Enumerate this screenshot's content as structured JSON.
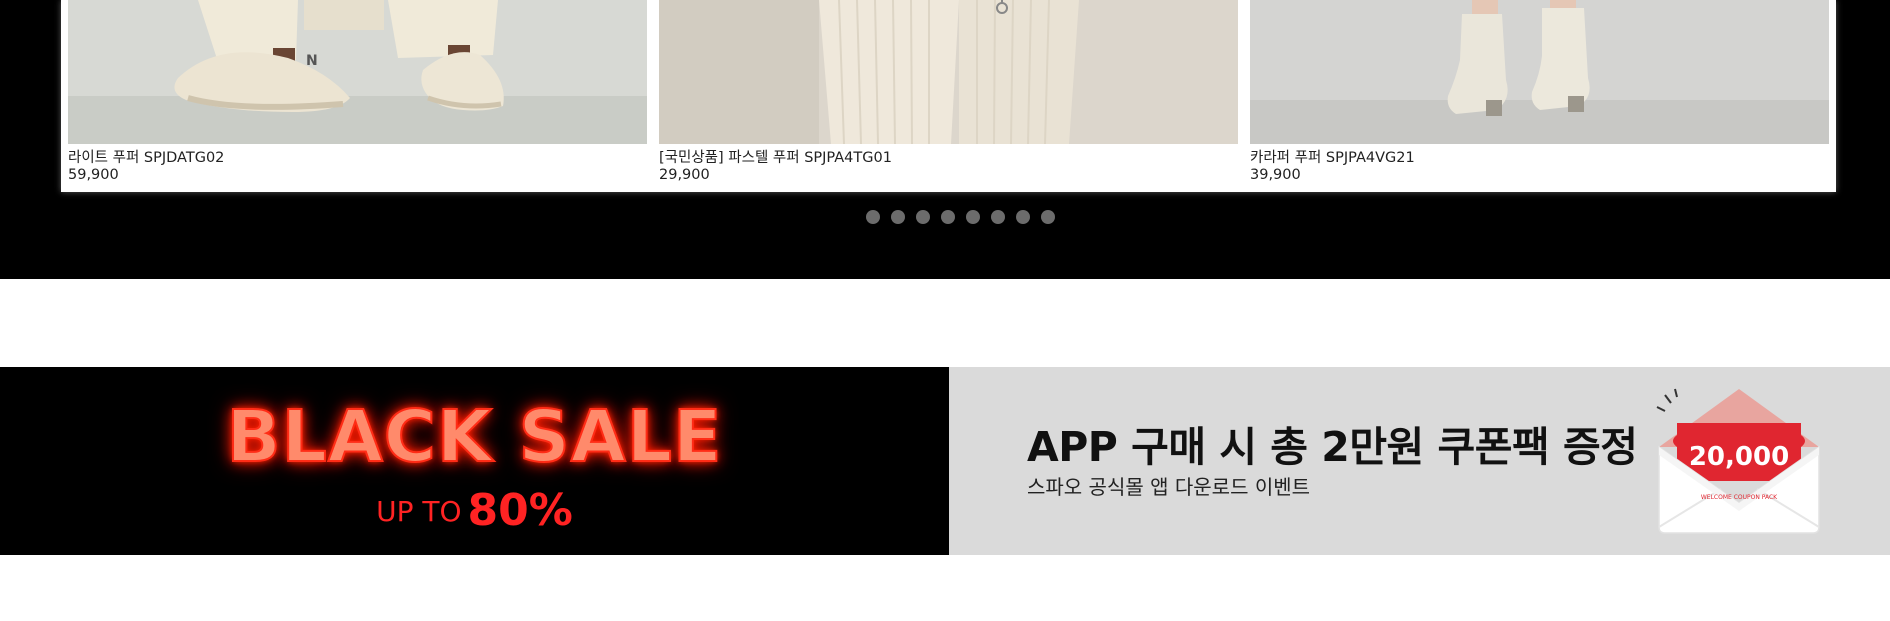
{
  "products": [
    {
      "name": "라이트 푸퍼 SPJDATG02",
      "price": "59,900",
      "image": "white-sneakers-photo"
    },
    {
      "name": "[국민상품] 파스텔 푸퍼 SPJPA4TG01",
      "price": "29,900",
      "image": "cream-corduroy-pants-photo"
    },
    {
      "name": "카라퍼 푸퍼 SPJPA4VG21",
      "price": "39,900",
      "image": "white-ankle-boots-photo"
    }
  ],
  "carousel": {
    "dot_count": 8
  },
  "banners": {
    "black_sale": {
      "title": "BLACK SALE",
      "prefix": "UP TO",
      "discount": "80%"
    },
    "app": {
      "title": "APP 구매 시 총 2만원 쿠폰팩 증정",
      "subtitle": "스파오 공식몰 앱 다운로드 이벤트",
      "coupon_amount": "20,000",
      "coupon_caption": "WELCOME COUPON PACK"
    }
  },
  "colors": {
    "background_dark": "#000000",
    "sale_red": "#ff2323",
    "app_banner_bg": "#dadada",
    "coupon_red": "#e02630",
    "carousel_dot": "#6c6c6c"
  }
}
